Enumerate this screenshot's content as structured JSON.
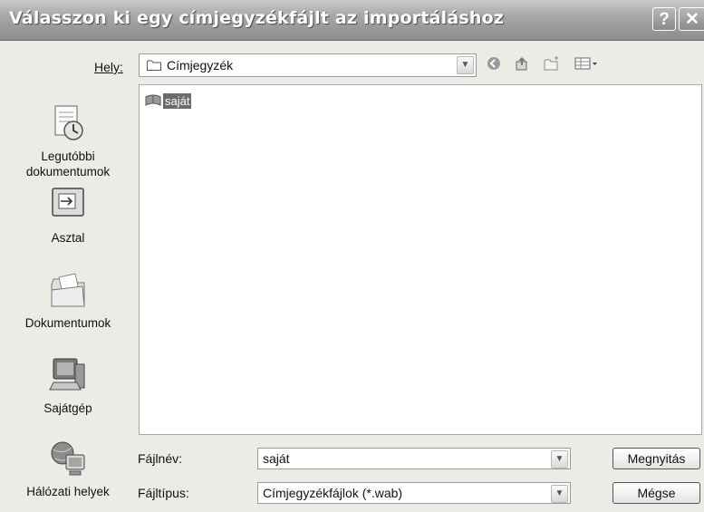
{
  "window": {
    "title": "Válasszon ki egy címjegyzékfájlt az importáláshoz",
    "help_glyph": "?",
    "close_glyph": "✕"
  },
  "location": {
    "label": "Hely:",
    "value": "Címjegyzék",
    "folder_icon": "folder-icon"
  },
  "toolbar": {
    "back_icon": "back-icon",
    "up_icon": "up-folder-icon",
    "new_folder_icon": "new-folder-icon",
    "views_icon": "views-menu-icon"
  },
  "places": [
    {
      "label": "Legutóbbi dokumentumok",
      "icon": "recent-documents-icon"
    },
    {
      "label": "Asztal",
      "icon": "desktop-icon"
    },
    {
      "label": "Dokumentumok",
      "icon": "my-documents-icon"
    },
    {
      "label": "Sajátgép",
      "icon": "my-computer-icon"
    },
    {
      "label": "Hálózati helyek",
      "icon": "network-places-icon"
    }
  ],
  "files": [
    {
      "name": "saját",
      "icon": "address-book-file-icon",
      "selected": true
    }
  ],
  "filename": {
    "label": "Fájlnév:",
    "value": "saját"
  },
  "filetype": {
    "label": "Fájltípus:",
    "value": "Címjegyzékfájlok (*.wab)"
  },
  "buttons": {
    "open": "Megnyitás",
    "cancel": "Mégse"
  },
  "colors": {
    "titlebar": "#9a9a9a",
    "selection": "#6b6b6b",
    "dialog_bg": "#ecebe6"
  }
}
